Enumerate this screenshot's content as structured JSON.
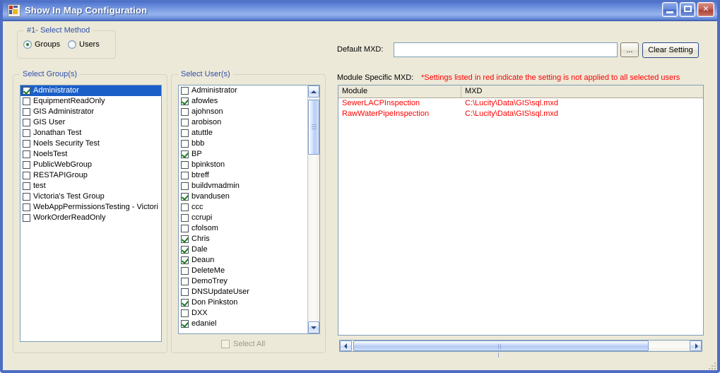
{
  "window": {
    "title": "Show In Map Configuration",
    "icon": "app-form-icon",
    "caption_buttons": [
      {
        "name": "minimize",
        "glyph": "minimize-icon"
      },
      {
        "name": "maximize",
        "glyph": "maximize-icon"
      },
      {
        "name": "close",
        "glyph": "close-icon",
        "label": "✕"
      }
    ]
  },
  "method_group": {
    "legend": "#1- Select Method",
    "options": [
      {
        "label": "Groups",
        "checked": true
      },
      {
        "label": "Users",
        "checked": false
      }
    ]
  },
  "groups_panel": {
    "legend": "Select Group(s)",
    "items": [
      {
        "label": "Administrator",
        "checked": true,
        "selected": true
      },
      {
        "label": "EquipmentReadOnly",
        "checked": false,
        "selected": false
      },
      {
        "label": "GIS Administrator",
        "checked": false,
        "selected": false
      },
      {
        "label": "GIS User",
        "checked": false,
        "selected": false
      },
      {
        "label": "Jonathan Test",
        "checked": false,
        "selected": false
      },
      {
        "label": "Noels Security Test",
        "checked": false,
        "selected": false
      },
      {
        "label": "NoelsTest",
        "checked": false,
        "selected": false
      },
      {
        "label": "PublicWebGroup",
        "checked": false,
        "selected": false
      },
      {
        "label": "RESTAPIGroup",
        "checked": false,
        "selected": false
      },
      {
        "label": "test",
        "checked": false,
        "selected": false
      },
      {
        "label": "Victoria's Test Group",
        "checked": false,
        "selected": false
      },
      {
        "label": "WebAppPermissionsTesting - Victori",
        "checked": false,
        "selected": false
      },
      {
        "label": "WorkOrderReadOnly",
        "checked": false,
        "selected": false
      }
    ]
  },
  "users_panel": {
    "legend": "Select User(s)",
    "select_all": {
      "label": "Select All",
      "checked": false,
      "enabled": false
    },
    "items": [
      {
        "label": "Administrator",
        "checked": false
      },
      {
        "label": "afowles",
        "checked": true
      },
      {
        "label": "ajohnson",
        "checked": false
      },
      {
        "label": "arobison",
        "checked": false
      },
      {
        "label": "atuttle",
        "checked": false
      },
      {
        "label": "bbb",
        "checked": false
      },
      {
        "label": "BP",
        "checked": true
      },
      {
        "label": "bpinkston",
        "checked": false
      },
      {
        "label": "btreff",
        "checked": false
      },
      {
        "label": "buildvmadmin",
        "checked": false
      },
      {
        "label": "bvandusen",
        "checked": true
      },
      {
        "label": "ccc",
        "checked": false
      },
      {
        "label": "ccrupi",
        "checked": false
      },
      {
        "label": "cfolsom",
        "checked": false
      },
      {
        "label": "Chris",
        "checked": true
      },
      {
        "label": "Dale",
        "checked": true
      },
      {
        "label": "Deaun",
        "checked": true
      },
      {
        "label": "DeleteMe",
        "checked": false
      },
      {
        "label": "DemoTrey",
        "checked": false
      },
      {
        "label": "DNSUpdateUser",
        "checked": false
      },
      {
        "label": "Don Pinkston",
        "checked": true
      },
      {
        "label": "DXX",
        "checked": false
      },
      {
        "label": "edaniel",
        "checked": true
      }
    ]
  },
  "default_mxd": {
    "label": "Default MXD:",
    "value": "",
    "placeholder": "",
    "browse_label": "...",
    "clear_label": "Clear Setting"
  },
  "module_specific": {
    "label": "Module Specific MXD:",
    "note": "*Settings listed in red indicate the setting is not applied to all selected users",
    "columns": [
      "Module",
      "MXD"
    ],
    "rows": [
      {
        "module": "SewerLACPInspection",
        "mxd": "C:\\Lucity\\Data\\GIS\\sql.mxd"
      },
      {
        "module": "RawWaterPipeInspection",
        "mxd": "C:\\Lucity\\Data\\GIS\\sql.mxd"
      }
    ]
  },
  "colors": {
    "window_bg": "#ece9d8",
    "title_accent": "#4d6dc4",
    "label_blue": "#2f4fa8",
    "alert_red": "#ff0000",
    "selection_blue": "#1a5fc8",
    "check_green": "#1b7a27"
  }
}
